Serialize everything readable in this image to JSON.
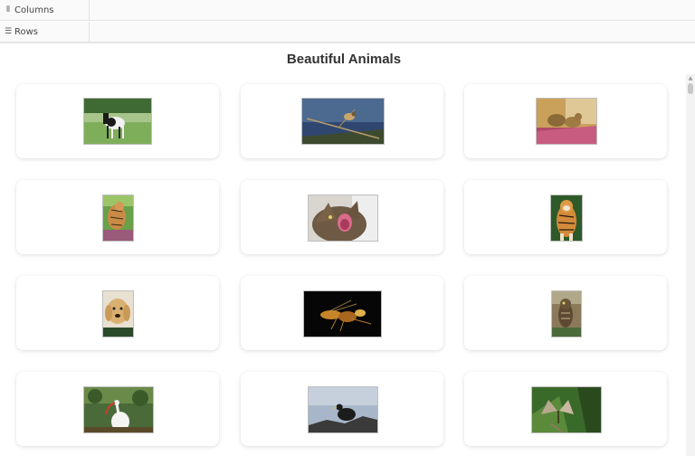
{
  "shelves": {
    "columns_label": "Columns",
    "rows_label": "Rows"
  },
  "viz": {
    "title": "Beautiful Animals"
  },
  "cards": [
    {
      "name": "horse-image"
    },
    {
      "name": "bird-branch-image"
    },
    {
      "name": "kittens-image"
    },
    {
      "name": "tiger-cub-image"
    },
    {
      "name": "cat-yawning-image"
    },
    {
      "name": "tiger-image"
    },
    {
      "name": "golden-retriever-image"
    },
    {
      "name": "wasp-image"
    },
    {
      "name": "owl-image"
    },
    {
      "name": "ibis-image"
    },
    {
      "name": "black-bird-image"
    },
    {
      "name": "butterfly-image"
    }
  ]
}
